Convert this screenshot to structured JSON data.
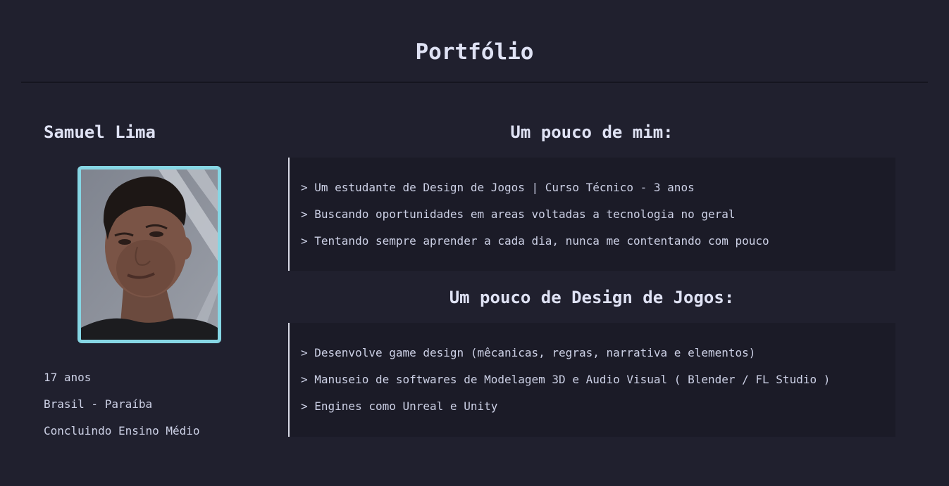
{
  "header": {
    "title": "Portfólio"
  },
  "profile": {
    "name": "Samuel Lima",
    "photo": "profile-photo",
    "info": [
      "17 anos",
      "Brasil - Paraíba",
      "Concluindo Ensino Médio"
    ]
  },
  "about": {
    "title": "Um pouco de mim:",
    "items": [
      "> Um estudante de Design de Jogos | Curso Técnico - 3 anos",
      "> Buscando oportunidades em areas voltadas a tecnologia no geral",
      "> Tentando sempre aprender a cada dia, nunca me contentando com pouco"
    ]
  },
  "design": {
    "title": "Um pouco de Design de Jogos:",
    "items": [
      "> Desenvolve game design (mêcanicas, regras, narrativa e elementos)",
      "> Manuseio de softwares de Modelagem 3D e Audio Visual ( Blender / FL Studio )",
      "> Engines como Unreal e Unity"
    ]
  },
  "colors": {
    "background": "#20202e",
    "panel": "#1b1b27",
    "accent": "#86d6e4",
    "text": "#cdd1e6"
  }
}
